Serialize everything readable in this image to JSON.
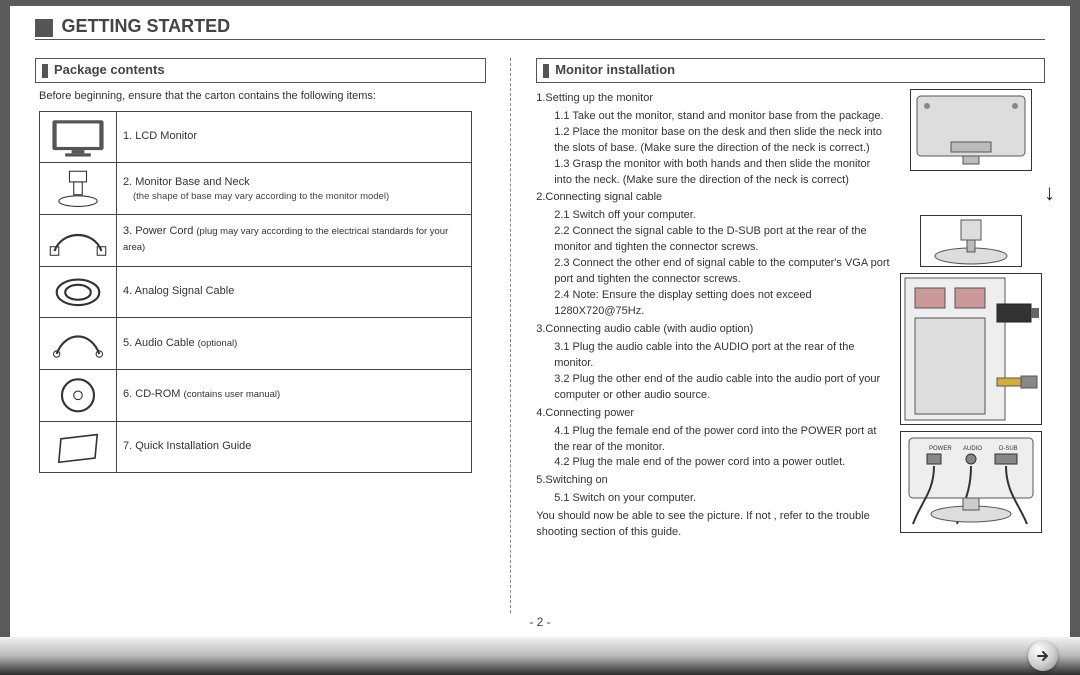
{
  "title": "GETTING STARTED",
  "page_number": "- 2 -",
  "left": {
    "heading": "Package contents",
    "intro": "Before beginning, ensure that the carton contains the following items:",
    "items": [
      {
        "num": "1.",
        "label": "LCD Monitor",
        "note": ""
      },
      {
        "num": "2.",
        "label": "Monitor Base and Neck",
        "note": "(the shape of base may vary according to the monitor model)"
      },
      {
        "num": "3.",
        "label": "Power Cord",
        "note": "(plug may vary according to the electrical standards for your area)"
      },
      {
        "num": "4.",
        "label": "Analog Signal Cable",
        "note": ""
      },
      {
        "num": "5.",
        "label": "Audio Cable",
        "note": "(optional)"
      },
      {
        "num": "6.",
        "label": "CD-ROM",
        "note": "(contains user manual)"
      },
      {
        "num": "7.",
        "label": "Quick Installation Guide",
        "note": ""
      }
    ]
  },
  "right": {
    "heading": "Monitor installation",
    "s1": "1.Setting up the monitor",
    "s1_1": "1.1 Take out the monitor, stand and monitor base from the package.",
    "s1_2": "1.2 Place the monitor base on the desk and then slide the neck into the slots of base. (Make sure the direction of the neck is correct.)",
    "s1_3": "1.3 Grasp the monitor with both hands and then slide the monitor into the neck. (Make sure the direction of the neck is correct)",
    "s2": "2.Connecting signal cable",
    "s2_1": "2.1 Switch off your computer.",
    "s2_2": "2.2 Connect the signal cable to the D-SUB  port at the rear of the monitor and tighten the connector screws.",
    "s2_3": "2.3 Connect the other end of signal cable to the computer's VGA port  port and tighten the connector screws.",
    "s2_4": "2.4 Note: Ensure the display setting does not exceed 1280X720@75Hz.",
    "s3": "3.Connecting audio cable (with audio option)",
    "s3_1": "3.1 Plug the audio cable into the AUDIO port at the rear of the monitor.",
    "s3_2": "3.2 Plug the other end of the audio cable into the audio port of your computer or other audio source.",
    "s4": "4.Connecting power",
    "s4_1": "4.1 Plug the female end of the power cord into the POWER port at the rear of the monitor.",
    "s4_2": "4.2 Plug the male end of the power cord into a power outlet.",
    "s5": "5.Switching on",
    "s5_1": "5.1 Switch on your computer.",
    "closing": "You should now be able to see the picture. If not , refer to the trouble shooting section of this guide.",
    "port_labels": {
      "power": "POWER",
      "audio": "AUDIO",
      "dsub": "D-SUB"
    }
  }
}
